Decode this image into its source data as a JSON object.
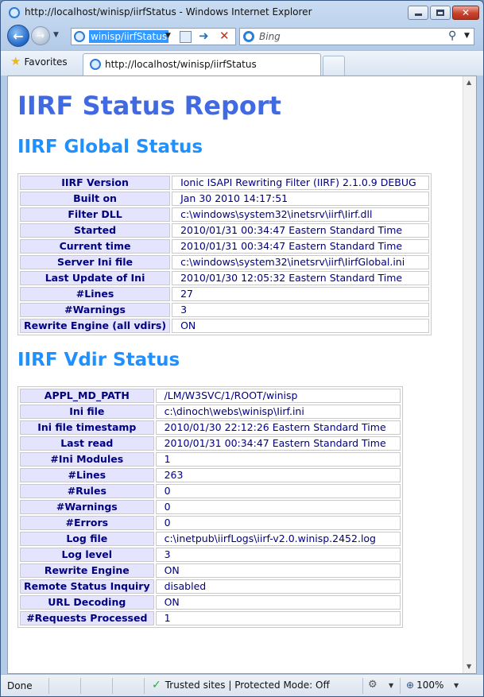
{
  "window": {
    "title": "http://localhost/winisp/iirfStatus - Windows Internet Explorer"
  },
  "navbar": {
    "address": "winisp/iirfStatus",
    "search_placeholder": "Bing",
    "icons": [
      "back-icon",
      "forward-icon",
      "dropdown-icon",
      "compat-view-icon",
      "go-icon",
      "stop-icon",
      "bing-icon",
      "search-icon"
    ]
  },
  "favbar": {
    "favorites_label": "Favorites",
    "tab_title": "http://localhost/winisp/iirfStatus"
  },
  "page": {
    "title": "IIRF Status Report",
    "global_heading": "IIRF Global Status",
    "vdir_heading": "IIRF Vdir Status",
    "title_color": "#4169e1",
    "heading_color": "#1e90ff",
    "key_bg_color": "#e4e4ff",
    "text_color": "#000080",
    "global_rows": [
      {
        "key": "IIRF Version",
        "value": "Ionic ISAPI Rewriting Filter (IIRF) 2.1.0.9 DEBUG"
      },
      {
        "key": "Built on",
        "value": "Jan 30 2010 14:17:51"
      },
      {
        "key": "Filter DLL",
        "value": "c:\\windows\\system32\\inetsrv\\iirf\\Iirf.dll"
      },
      {
        "key": "Started",
        "value": "2010/01/31 00:34:47 Eastern Standard Time"
      },
      {
        "key": "Current time",
        "value": "2010/01/31 00:34:47 Eastern Standard Time"
      },
      {
        "key": "Server Ini file",
        "value": "c:\\windows\\system32\\inetsrv\\iirf\\IirfGlobal.ini"
      },
      {
        "key": "Last Update of Ini",
        "value": "2010/01/30 12:05:32 Eastern Standard Time"
      },
      {
        "key": "#Lines",
        "value": "27"
      },
      {
        "key": "#Warnings",
        "value": "3"
      },
      {
        "key": "Rewrite Engine (all vdirs)",
        "value": "ON"
      }
    ],
    "vdir_rows": [
      {
        "key": "APPL_MD_PATH",
        "value": "/LM/W3SVC/1/ROOT/winisp"
      },
      {
        "key": "Ini file",
        "value": "c:\\dinoch\\webs\\winisp\\Iirf.ini"
      },
      {
        "key": "Ini file timestamp",
        "value": "2010/01/30 22:12:26 Eastern Standard Time"
      },
      {
        "key": "Last read",
        "value": "2010/01/31 00:34:47 Eastern Standard Time"
      },
      {
        "key": "#Ini Modules",
        "value": "1"
      },
      {
        "key": "#Lines",
        "value": "263"
      },
      {
        "key": "#Rules",
        "value": "0"
      },
      {
        "key": "#Warnings",
        "value": "0"
      },
      {
        "key": "#Errors",
        "value": "0"
      },
      {
        "key": "Log file",
        "value": "c:\\inetpub\\iirfLogs\\iirf-v2.0.winisp.2452.log"
      },
      {
        "key": "Log level",
        "value": "3"
      },
      {
        "key": "Rewrite Engine",
        "value": "ON"
      },
      {
        "key": "Remote Status Inquiry",
        "value": "disabled"
      },
      {
        "key": "URL Decoding",
        "value": "ON"
      },
      {
        "key": "#Requests Processed",
        "value": "1"
      }
    ]
  },
  "statusbar": {
    "status": "Done",
    "zone": "Trusted sites | Protected Mode: Off",
    "zoom": "100%"
  }
}
